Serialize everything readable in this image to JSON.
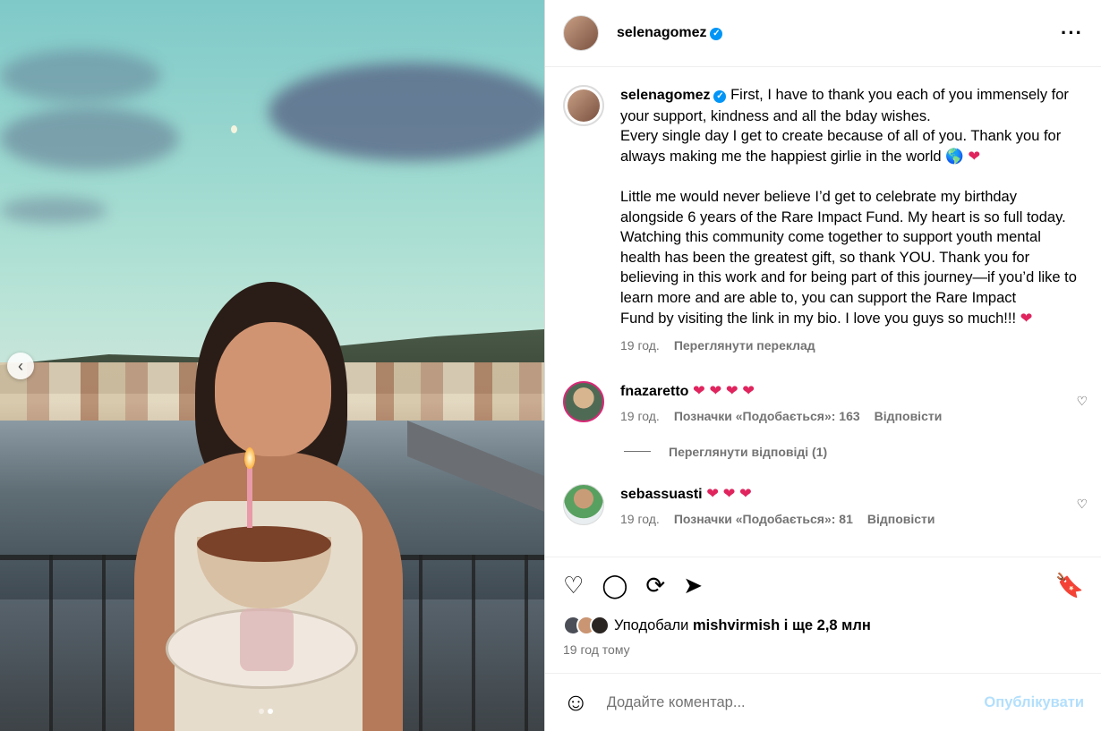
{
  "post": {
    "author": "selenagomez",
    "verified_mark": "✓",
    "more_glyph": "···"
  },
  "media": {
    "prev_glyph": "‹",
    "slides_total": 2,
    "active_slide": 2
  },
  "caption": {
    "username": "selenagomez",
    "p1": "First, I have to thank you each of you immensely for your support, kindness and all the bday wishes.\nEvery single day I get to create because of all of you. Thank you for always making me the happiest girlie in the world",
    "p1_emoji_globe": "🌎",
    "p1_emoji_heart": "❤",
    "p2": "Little me would never believe I’d get to celebrate my birthday alongside 6 years of the Rare Impact Fund. My heart is so full today. Watching this community come together to support youth mental health has been the greatest gift, so thank YOU. Thank you for believing in this work and for being part of this journey—if you’d like to learn more and are able to, you can support the Rare Impact\nFund by visiting the link in my bio. I love you guys so much!!!",
    "p2_emoji_heart": "❤",
    "time": "19 год.",
    "translate_label": "Переглянути переклад"
  },
  "comments": [
    {
      "username": "fnazaretto",
      "text": "❤ ❤ ❤ ❤",
      "time": "19 год.",
      "likes": "Позначки «Подобається»: 163",
      "reply_label": "Відповісти",
      "view_replies": "Переглянути відповіді (1)"
    },
    {
      "username": "sebassuasti",
      "text": "❤ ❤ ❤",
      "time": "19 год.",
      "likes": "Позначки «Подобається»: 81",
      "reply_label": "Відповісти"
    }
  ],
  "actions": {
    "like": "♡",
    "comment": "◯",
    "share": "⟳",
    "send": "➤",
    "save": "🔖"
  },
  "likes": {
    "prefix": "Уподобали",
    "user": "mishvirmish",
    "suffix": "і ще 2,8 млн"
  },
  "posted": "19 год тому",
  "composer": {
    "emoji": "☺",
    "placeholder": "Додайте коментар...",
    "post_label": "Опублікувати"
  },
  "colors": {
    "accent": "#0095f6",
    "heart": "#e0245e",
    "muted": "#737373",
    "post_disabled": "#b2dffc"
  }
}
